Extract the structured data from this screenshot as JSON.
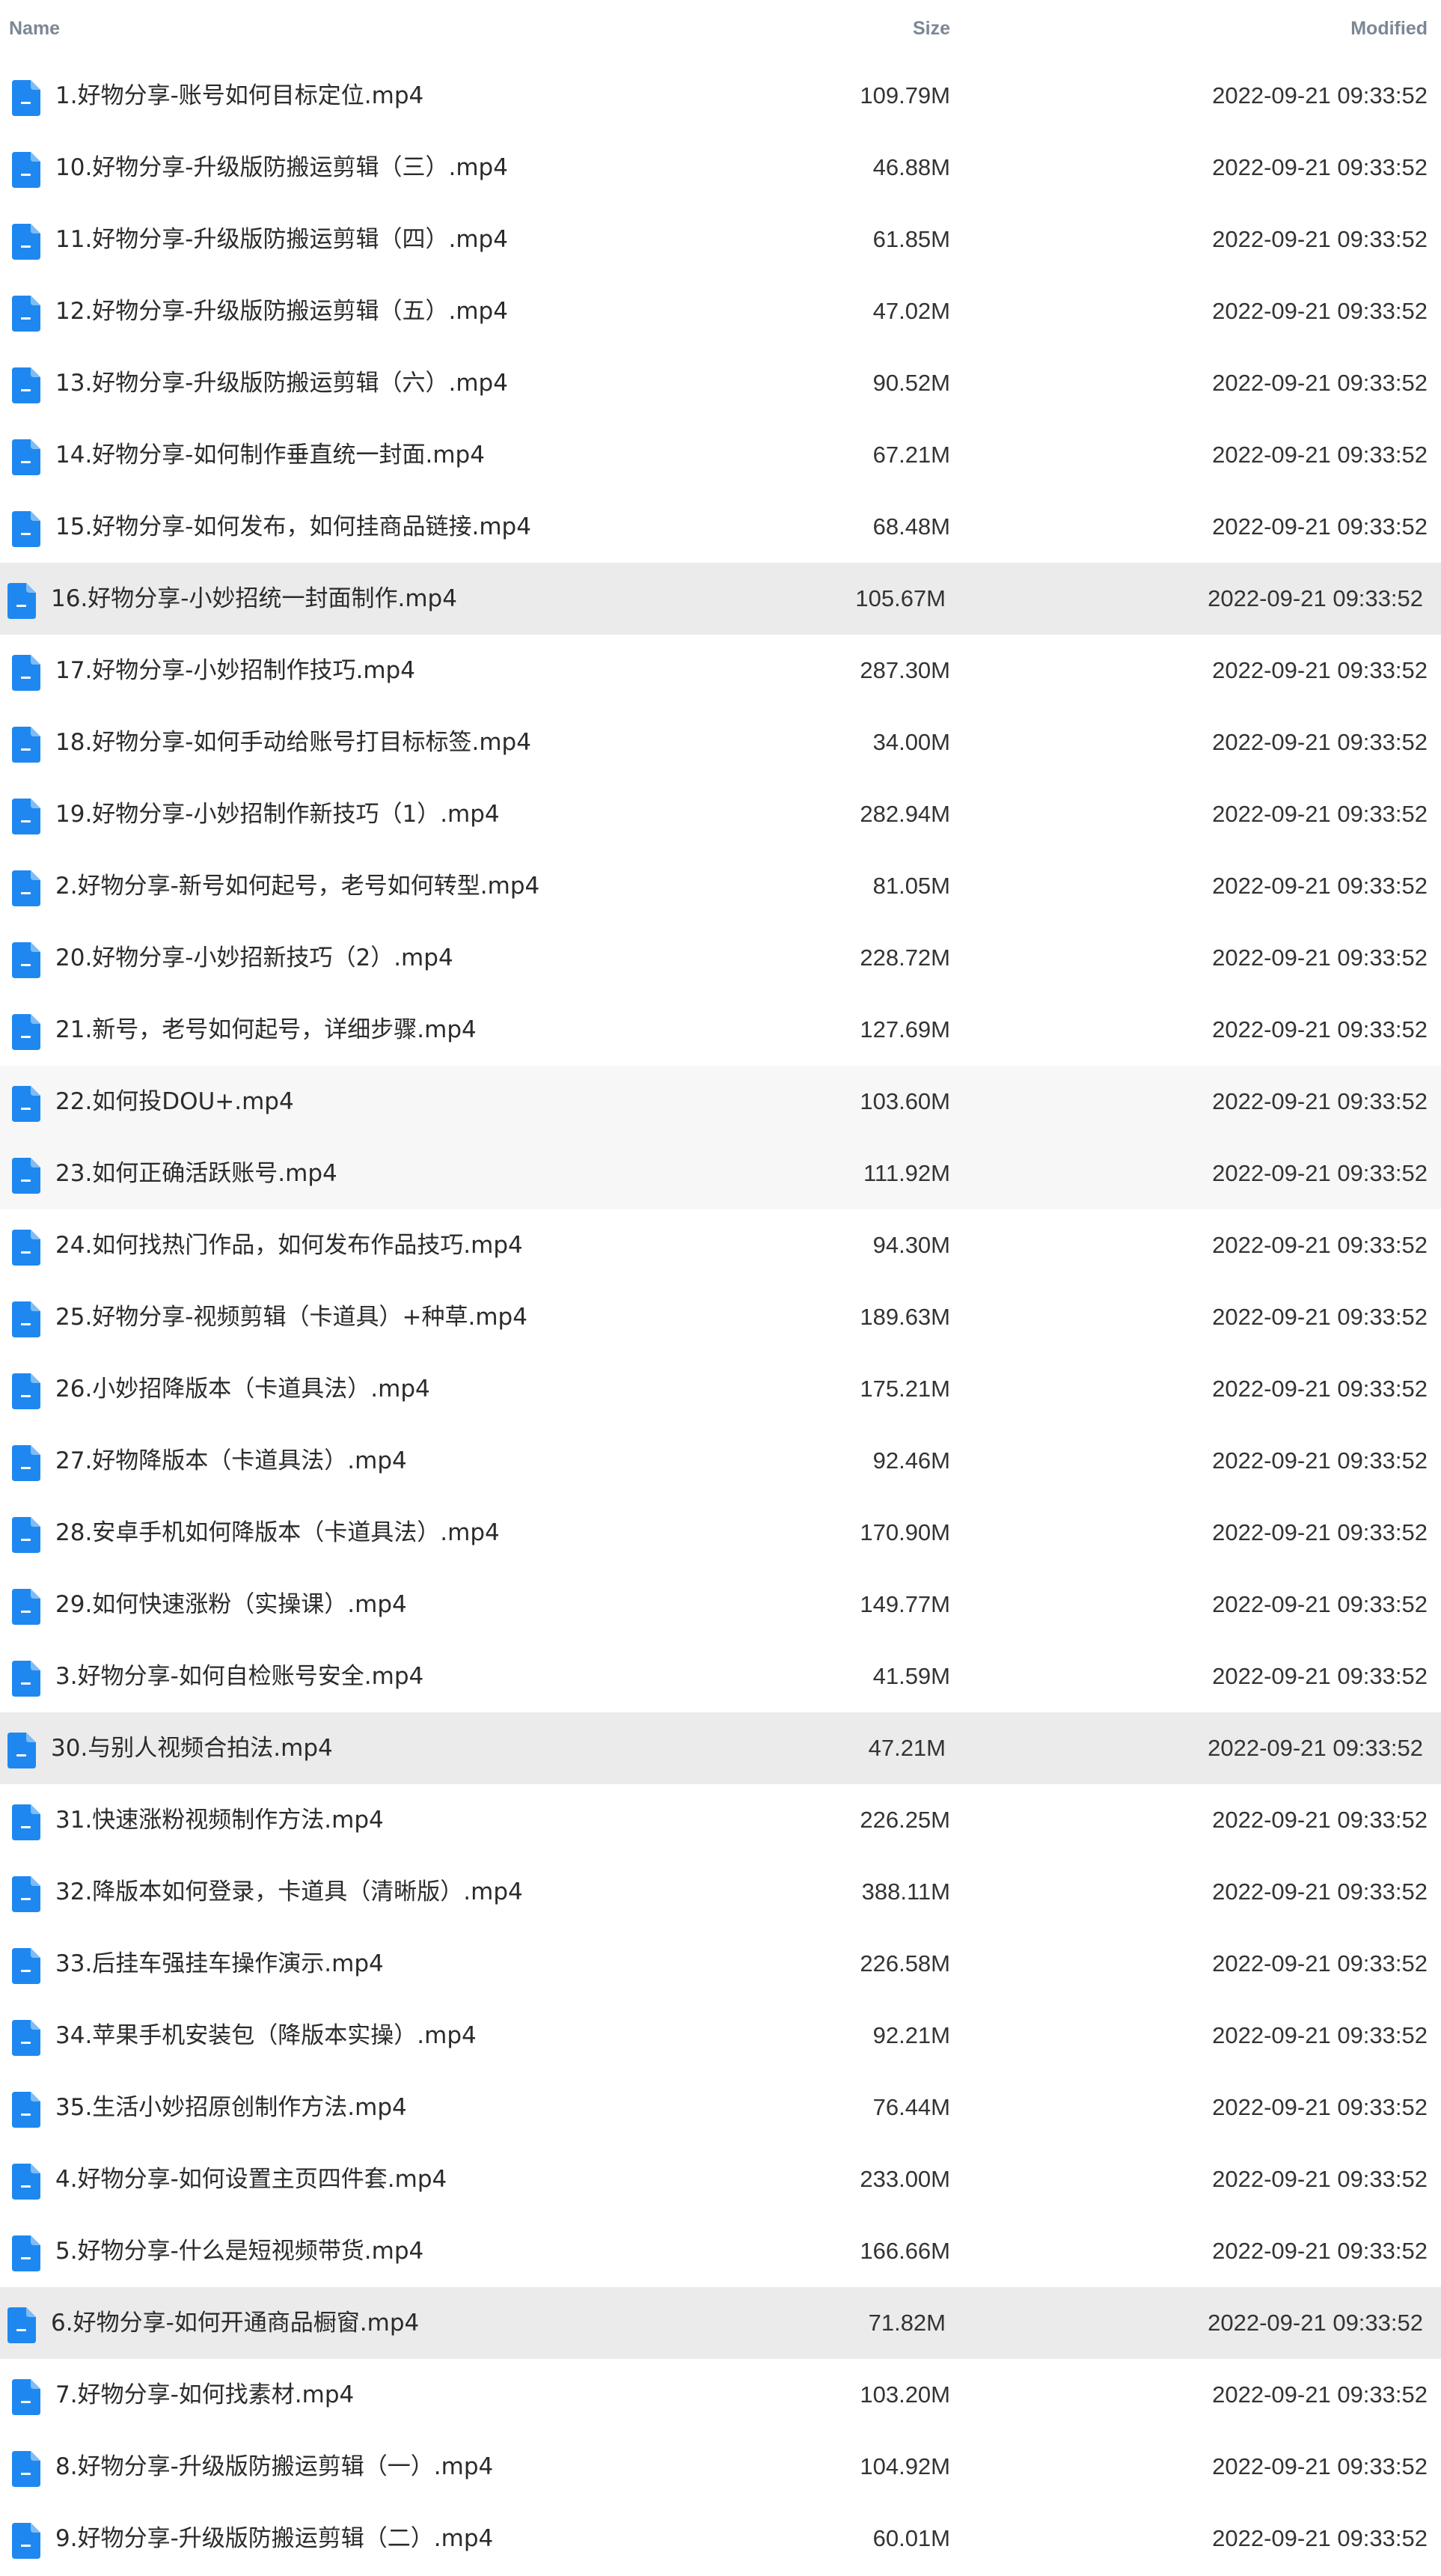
{
  "header": {
    "name_label": "Name",
    "size_label": "Size",
    "modified_label": "Modified"
  },
  "colors": {
    "icon_blue": "#1e88f0",
    "header_text": "#7c8794",
    "row_highlight": "#ebebeb",
    "row_light": "#f7f7f7"
  },
  "files": [
    {
      "name": "1.好物分享-账号如何目标定位.mp4",
      "size": "109.79M",
      "modified": "2022-09-21 09:33:52",
      "icon": "file-icon",
      "highlight": ""
    },
    {
      "name": "10.好物分享-升级版防搬运剪辑（三）.mp4",
      "size": "46.88M",
      "modified": "2022-09-21 09:33:52",
      "icon": "file-icon",
      "highlight": ""
    },
    {
      "name": "11.好物分享-升级版防搬运剪辑（四）.mp4",
      "size": "61.85M",
      "modified": "2022-09-21 09:33:52",
      "icon": "file-icon",
      "highlight": ""
    },
    {
      "name": "12.好物分享-升级版防搬运剪辑（五）.mp4",
      "size": "47.02M",
      "modified": "2022-09-21 09:33:52",
      "icon": "file-icon",
      "highlight": ""
    },
    {
      "name": "13.好物分享-升级版防搬运剪辑（六）.mp4",
      "size": "90.52M",
      "modified": "2022-09-21 09:33:52",
      "icon": "file-icon",
      "highlight": ""
    },
    {
      "name": "14.好物分享-如何制作垂直统一封面.mp4",
      "size": "67.21M",
      "modified": "2022-09-21 09:33:52",
      "icon": "file-icon",
      "highlight": ""
    },
    {
      "name": "15.好物分享-如何发布，如何挂商品链接.mp4",
      "size": "68.48M",
      "modified": "2022-09-21 09:33:52",
      "icon": "file-icon",
      "highlight": ""
    },
    {
      "name": "16.好物分享-小妙招统一封面制作.mp4",
      "size": "105.67M",
      "modified": "2022-09-21 09:33:52",
      "icon": "file-icon",
      "highlight": "strong"
    },
    {
      "name": "17.好物分享-小妙招制作技巧.mp4",
      "size": "287.30M",
      "modified": "2022-09-21 09:33:52",
      "icon": "file-icon",
      "highlight": ""
    },
    {
      "name": "18.好物分享-如何手动给账号打目标标签.mp4",
      "size": "34.00M",
      "modified": "2022-09-21 09:33:52",
      "icon": "file-icon",
      "highlight": ""
    },
    {
      "name": "19.好物分享-小妙招制作新技巧（1）.mp4",
      "size": "282.94M",
      "modified": "2022-09-21 09:33:52",
      "icon": "file-icon",
      "highlight": ""
    },
    {
      "name": "2.好物分享-新号如何起号，老号如何转型.mp4",
      "size": "81.05M",
      "modified": "2022-09-21 09:33:52",
      "icon": "file-icon",
      "highlight": ""
    },
    {
      "name": "20.好物分享-小妙招新技巧（2）.mp4",
      "size": "228.72M",
      "modified": "2022-09-21 09:33:52",
      "icon": "file-icon",
      "highlight": ""
    },
    {
      "name": "21.新号，老号如何起号，详细步骤.mp4",
      "size": "127.69M",
      "modified": "2022-09-21 09:33:52",
      "icon": "file-icon",
      "highlight": ""
    },
    {
      "name": "22.如何投DOU+.mp4",
      "size": "103.60M",
      "modified": "2022-09-21 09:33:52",
      "icon": "file-icon",
      "highlight": "light"
    },
    {
      "name": "23.如何正确活跃账号.mp4",
      "size": "111.92M",
      "modified": "2022-09-21 09:33:52",
      "icon": "file-icon",
      "highlight": "light"
    },
    {
      "name": "24.如何找热门作品，如何发布作品技巧.mp4",
      "size": "94.30M",
      "modified": "2022-09-21 09:33:52",
      "icon": "file-icon",
      "highlight": ""
    },
    {
      "name": "25.好物分享-视频剪辑（卡道具）+种草.mp4",
      "size": "189.63M",
      "modified": "2022-09-21 09:33:52",
      "icon": "file-icon",
      "highlight": ""
    },
    {
      "name": "26.小妙招降版本（卡道具法）.mp4",
      "size": "175.21M",
      "modified": "2022-09-21 09:33:52",
      "icon": "file-icon",
      "highlight": ""
    },
    {
      "name": "27.好物降版本（卡道具法）.mp4",
      "size": "92.46M",
      "modified": "2022-09-21 09:33:52",
      "icon": "file-icon",
      "highlight": ""
    },
    {
      "name": "28.安卓手机如何降版本（卡道具法）.mp4",
      "size": "170.90M",
      "modified": "2022-09-21 09:33:52",
      "icon": "file-icon",
      "highlight": ""
    },
    {
      "name": "29.如何快速涨粉（实操课）.mp4",
      "size": "149.77M",
      "modified": "2022-09-21 09:33:52",
      "icon": "file-icon",
      "highlight": ""
    },
    {
      "name": "3.好物分享-如何自检账号安全.mp4",
      "size": "41.59M",
      "modified": "2022-09-21 09:33:52",
      "icon": "file-icon",
      "highlight": ""
    },
    {
      "name": "30.与别人视频合拍法.mp4",
      "size": "47.21M",
      "modified": "2022-09-21 09:33:52",
      "icon": "file-icon",
      "highlight": "strong"
    },
    {
      "name": "31.快速涨粉视频制作方法.mp4",
      "size": "226.25M",
      "modified": "2022-09-21 09:33:52",
      "icon": "file-icon",
      "highlight": ""
    },
    {
      "name": "32.降版本如何登录，卡道具（清晰版）.mp4",
      "size": "388.11M",
      "modified": "2022-09-21 09:33:52",
      "icon": "file-icon",
      "highlight": ""
    },
    {
      "name": "33.后挂车强挂车操作演示.mp4",
      "size": "226.58M",
      "modified": "2022-09-21 09:33:52",
      "icon": "file-icon",
      "highlight": ""
    },
    {
      "name": "34.苹果手机安装包（降版本实操）.mp4",
      "size": "92.21M",
      "modified": "2022-09-21 09:33:52",
      "icon": "file-icon",
      "highlight": ""
    },
    {
      "name": "35.生活小妙招原创制作方法.mp4",
      "size": "76.44M",
      "modified": "2022-09-21 09:33:52",
      "icon": "file-icon",
      "highlight": ""
    },
    {
      "name": "4.好物分享-如何设置主页四件套.mp4",
      "size": "233.00M",
      "modified": "2022-09-21 09:33:52",
      "icon": "file-icon",
      "highlight": ""
    },
    {
      "name": "5.好物分享-什么是短视频带货.mp4",
      "size": "166.66M",
      "modified": "2022-09-21 09:33:52",
      "icon": "file-icon",
      "highlight": ""
    },
    {
      "name": "6.好物分享-如何开通商品橱窗.mp4",
      "size": "71.82M",
      "modified": "2022-09-21 09:33:52",
      "icon": "file-icon",
      "highlight": "strong"
    },
    {
      "name": "7.好物分享-如何找素材.mp4",
      "size": "103.20M",
      "modified": "2022-09-21 09:33:52",
      "icon": "file-icon",
      "highlight": ""
    },
    {
      "name": "8.好物分享-升级版防搬运剪辑（一）.mp4",
      "size": "104.92M",
      "modified": "2022-09-21 09:33:52",
      "icon": "file-icon",
      "highlight": ""
    },
    {
      "name": "9.好物分享-升级版防搬运剪辑（二）.mp4",
      "size": "60.01M",
      "modified": "2022-09-21 09:33:52",
      "icon": "file-icon",
      "highlight": ""
    }
  ]
}
